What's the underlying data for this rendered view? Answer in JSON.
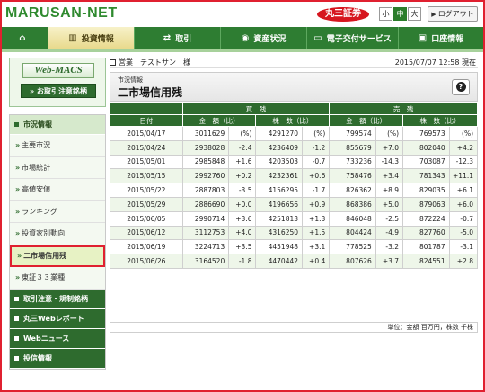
{
  "header": {
    "logo": "MARUSAN-NET",
    "brand": "丸三証券",
    "sizes": [
      "小",
      "中",
      "大"
    ],
    "logout_label": "ログアウト"
  },
  "topnav": [
    {
      "label": "",
      "icon": "home-icon",
      "glyph": "⌂"
    },
    {
      "label": "投資情報",
      "icon": "chart-icon",
      "glyph": "▥"
    },
    {
      "label": "取引",
      "icon": "trade-arrows-icon",
      "glyph": "⇄"
    },
    {
      "label": "資産状況",
      "icon": "coins-icon",
      "glyph": "◉"
    },
    {
      "label": "電子交付サービス",
      "icon": "monitor-icon",
      "glyph": "▭"
    },
    {
      "label": "口座情報",
      "icon": "account-icon",
      "glyph": "▣"
    }
  ],
  "sidebar": {
    "webmacs_label": "Web-MACS",
    "watchlist_button": "お取引注意銘柄",
    "section_market": "市況情報",
    "items": [
      "主要市況",
      "市場統計",
      "高値安値",
      "ランキング",
      "投資家別動向",
      "二市場信用残",
      "東証３３業種"
    ],
    "sections": [
      "取引注意・規制銘柄",
      "丸三Webレポート",
      "Webニュース",
      "投信情報"
    ]
  },
  "main": {
    "account": "営業　テストサン　様",
    "datetime": "2015/07/07 12:58 現在",
    "subtitle": "市況情報",
    "title": "二市場信用残",
    "help": "?"
  },
  "table": {
    "group_headers": [
      "買　残",
      "売　残"
    ],
    "columns": [
      "日付",
      "金　額（比）",
      "株　数（比）",
      "金　額（比）",
      "株　数（比）"
    ],
    "rows": [
      [
        "2015/04/17",
        "3011629",
        "(%)",
        "4291270",
        "(%)",
        "799574",
        "(%)",
        "769573",
        "(%)"
      ],
      [
        "2015/04/24",
        "2938028",
        "-2.4",
        "4236409",
        "-1.2",
        "855679",
        "+7.0",
        "802040",
        "+4.2"
      ],
      [
        "2015/05/01",
        "2985848",
        "+1.6",
        "4203503",
        "-0.7",
        "733236",
        "-14.3",
        "703087",
        "-12.3"
      ],
      [
        "2015/05/15",
        "2992760",
        "+0.2",
        "4232361",
        "+0.6",
        "758476",
        "+3.4",
        "781343",
        "+11.1"
      ],
      [
        "2015/05/22",
        "2887803",
        "-3.5",
        "4156295",
        "-1.7",
        "826362",
        "+8.9",
        "829035",
        "+6.1"
      ],
      [
        "2015/05/29",
        "2886690",
        "+0.0",
        "4196656",
        "+0.9",
        "868386",
        "+5.0",
        "879063",
        "+6.0"
      ],
      [
        "2015/06/05",
        "2990714",
        "+3.6",
        "4251813",
        "+1.3",
        "846048",
        "-2.5",
        "872224",
        "-0.7"
      ],
      [
        "2015/06/12",
        "3112753",
        "+4.0",
        "4316250",
        "+1.5",
        "804424",
        "-4.9",
        "827760",
        "-5.0"
      ],
      [
        "2015/06/19",
        "3224713",
        "+3.5",
        "4451948",
        "+3.1",
        "778525",
        "-3.2",
        "801787",
        "-3.1"
      ],
      [
        "2015/06/26",
        "3164520",
        "-1.8",
        "4470442",
        "+0.4",
        "807626",
        "+3.7",
        "824551",
        "+2.8"
      ]
    ],
    "unit_note": "単位：金額 百万円，株数 千株"
  }
}
